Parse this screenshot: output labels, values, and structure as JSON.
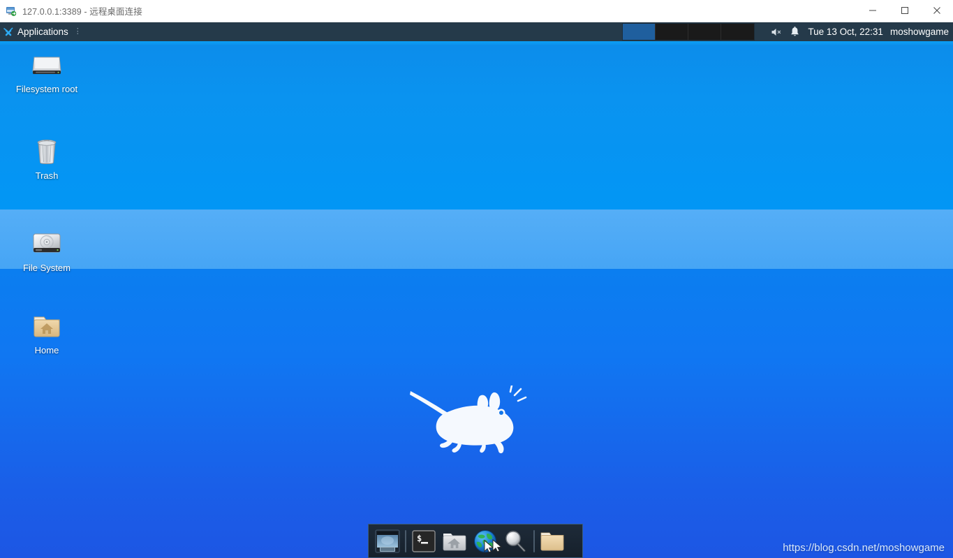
{
  "window": {
    "title": "127.0.0.1:3389 - 远程桌面连接",
    "icon": "remote-desktop-icon",
    "controls": {
      "minimize": "minimize-icon",
      "maximize": "maximize-icon",
      "close": "close-icon"
    }
  },
  "panel": {
    "applications_label": "Applications",
    "applications_icon": "xfce-mouse-icon",
    "applications_dots": "⋮",
    "workspaces": [
      {
        "name": "workspace-1",
        "active": true
      },
      {
        "name": "workspace-2",
        "active": false
      },
      {
        "name": "workspace-3",
        "active": false
      },
      {
        "name": "workspace-4",
        "active": false
      }
    ],
    "tray": [
      {
        "name": "volume-muted-icon",
        "label": "Volume muted"
      },
      {
        "name": "notification-bell-icon",
        "label": "Notifications"
      }
    ],
    "clock": "Tue 13 Oct, 22:31",
    "username": "moshowgame",
    "accent_color": "#0b9ef5",
    "background_color": "#253a4a"
  },
  "desktop": {
    "icons": [
      {
        "name": "filesystem-root",
        "label": "Filesystem root",
        "icon": "hard-drive-icon"
      },
      {
        "name": "trash",
        "label": "Trash",
        "icon": "trash-can-icon"
      },
      {
        "name": "file-system",
        "label": "File System",
        "icon": "disk-drive-icon"
      },
      {
        "name": "home",
        "label": "Home",
        "icon": "home-folder-icon"
      }
    ],
    "logo": "xfce-mouse-logo",
    "wallpaper_colors": [
      "#0a93f0",
      "#4ba8f6",
      "#1a5fe8"
    ]
  },
  "dock": {
    "items": [
      {
        "name": "show-desktop",
        "icon": "show-desktop-icon"
      },
      {
        "name": "separator-1",
        "icon": "separator"
      },
      {
        "name": "terminal",
        "icon": "terminal-icon"
      },
      {
        "name": "file-manager-home",
        "icon": "home-folder-icon"
      },
      {
        "name": "web-browser",
        "icon": "globe-icon"
      },
      {
        "name": "search",
        "icon": "magnifier-icon"
      },
      {
        "name": "separator-2",
        "icon": "separator"
      },
      {
        "name": "file-manager",
        "icon": "folder-icon"
      }
    ]
  },
  "watermark": "https://blog.csdn.net/moshowgame"
}
